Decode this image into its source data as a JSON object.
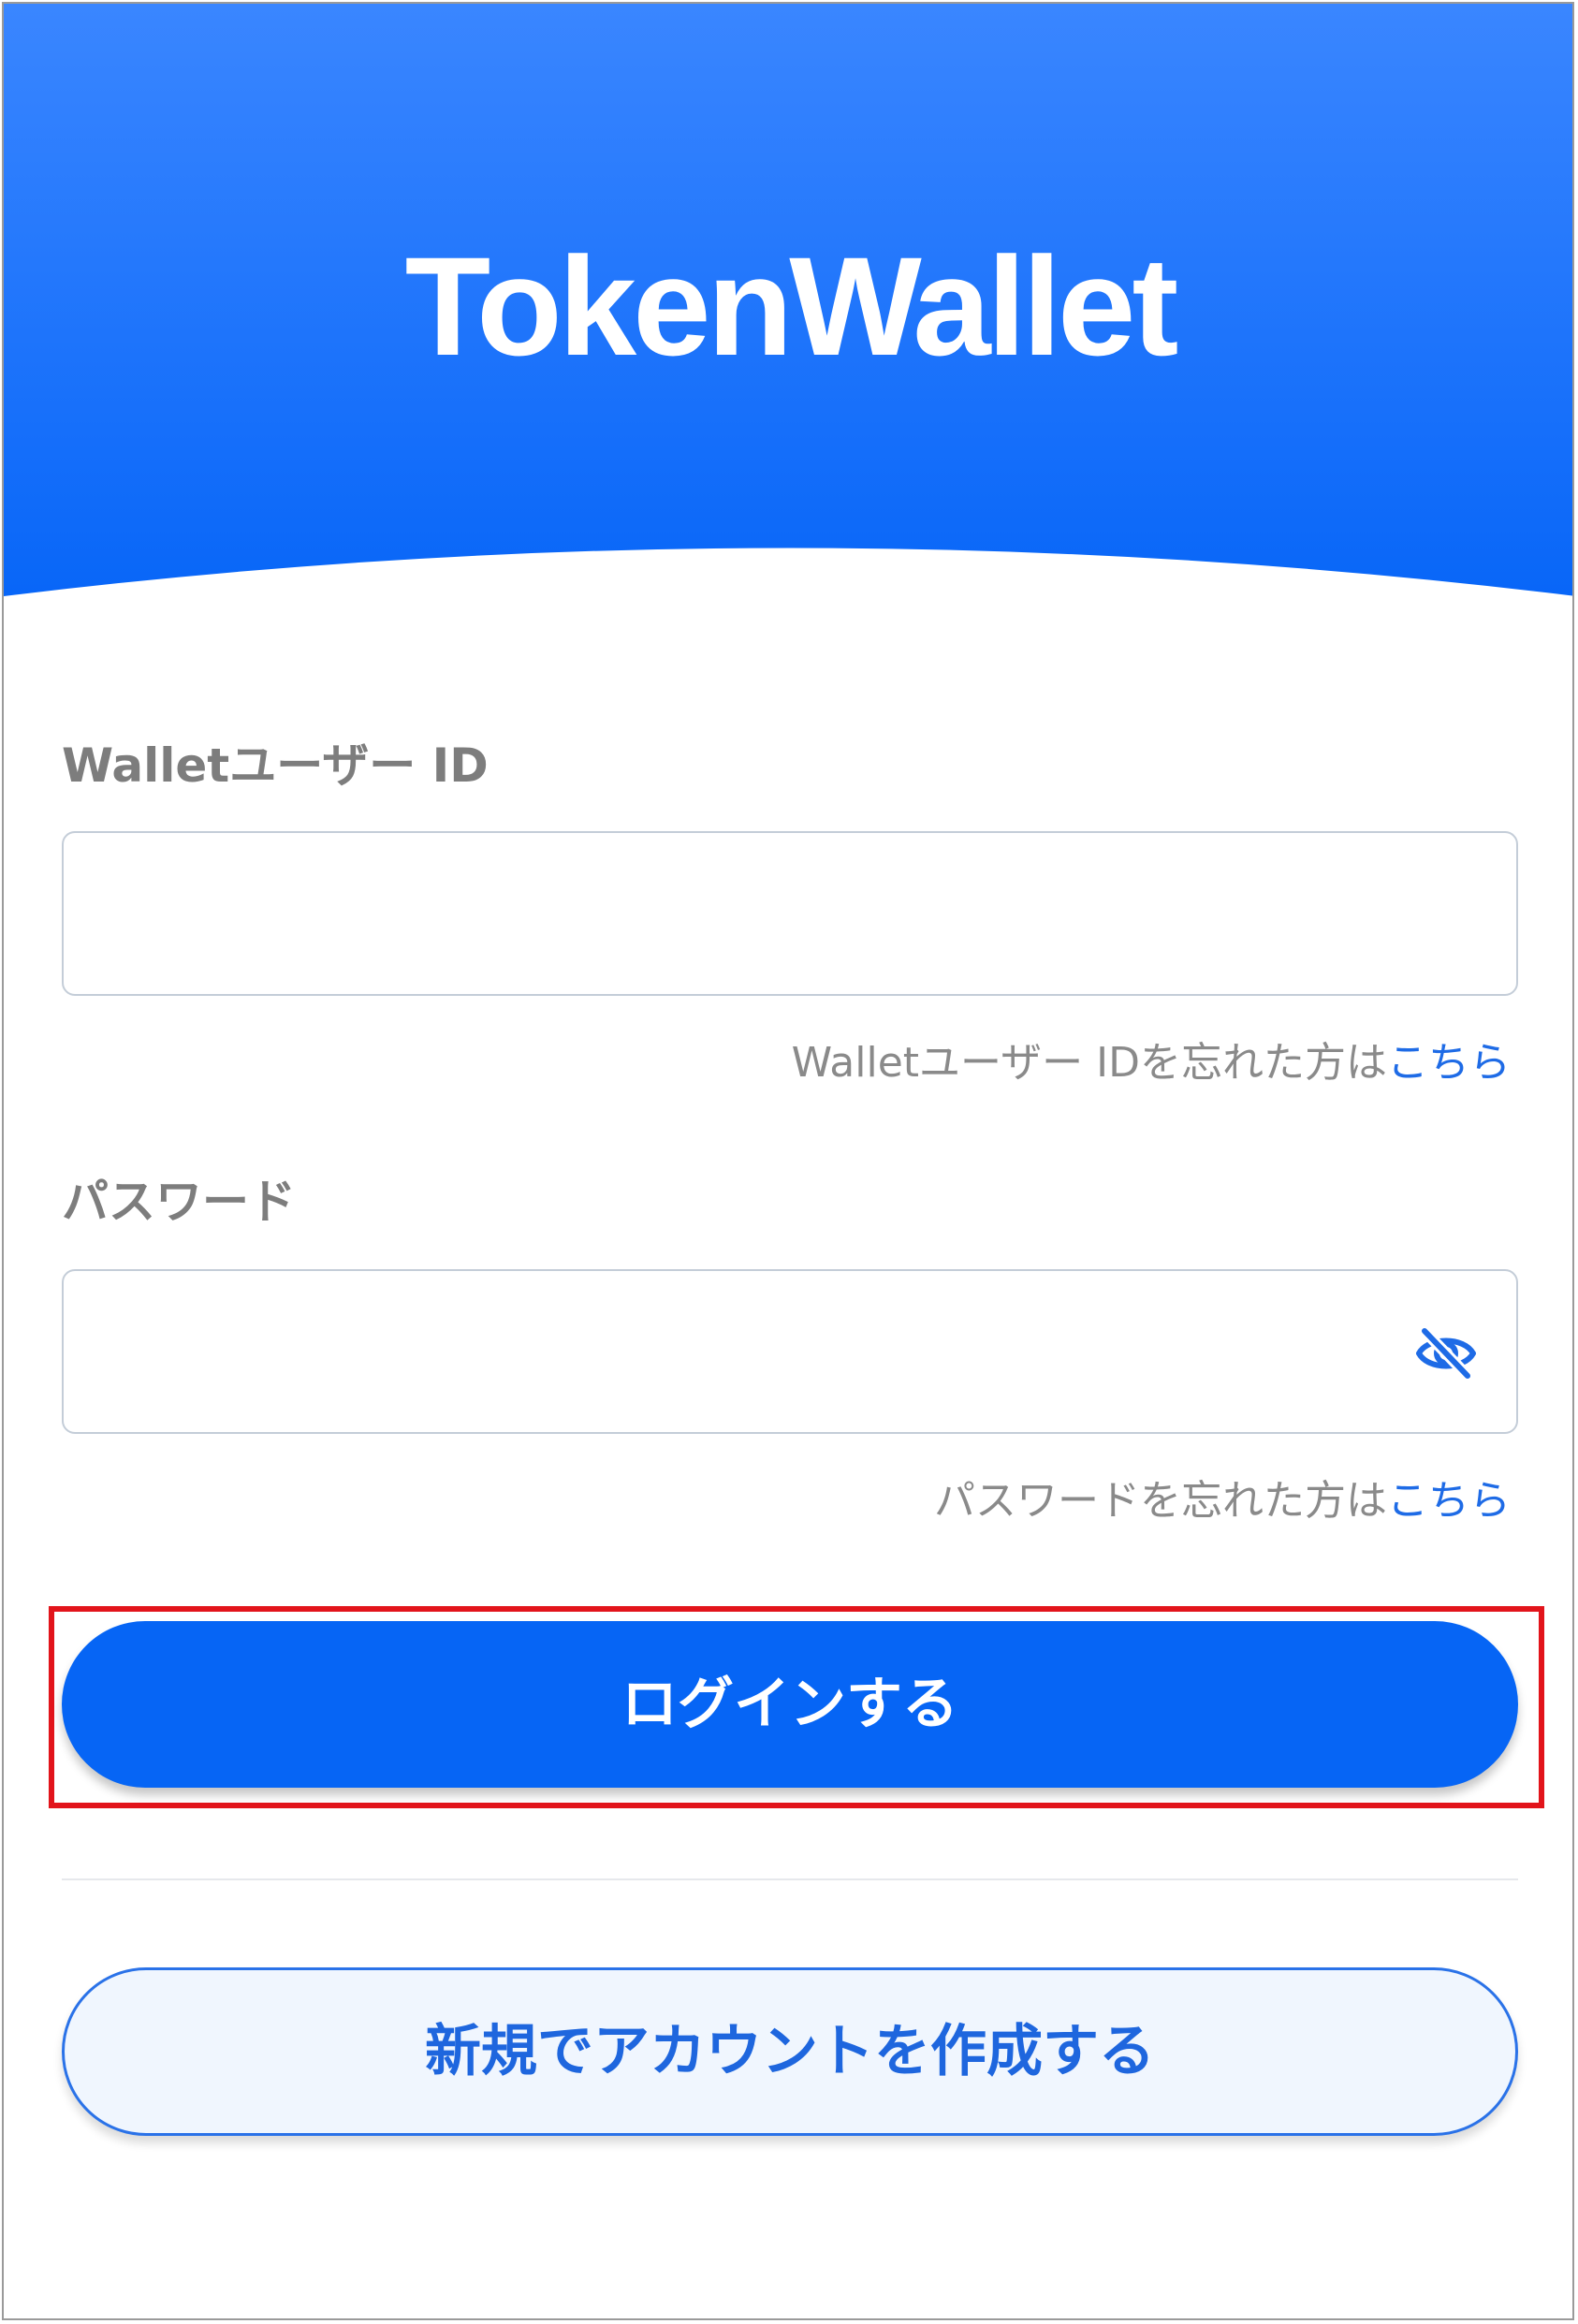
{
  "header": {
    "logo_text": "TokenWallet",
    "gradient_top": "#3a86ff",
    "gradient_bottom": "#0866f8"
  },
  "user_id": {
    "label": "Walletユーザー ID",
    "value": "",
    "forgot_text": "Walletユーザー IDを忘れた方は",
    "forgot_link": "こちら"
  },
  "password": {
    "label": "パスワード",
    "value": "",
    "visibility_icon": "eye-off-icon",
    "forgot_text": "パスワードを忘れた方は",
    "forgot_link": "こちら"
  },
  "login_button": {
    "label": "ログインする",
    "color": "#0665f5"
  },
  "signup_button": {
    "label": "新規でアカウントを作成する"
  },
  "highlight_color": "#e2141b"
}
